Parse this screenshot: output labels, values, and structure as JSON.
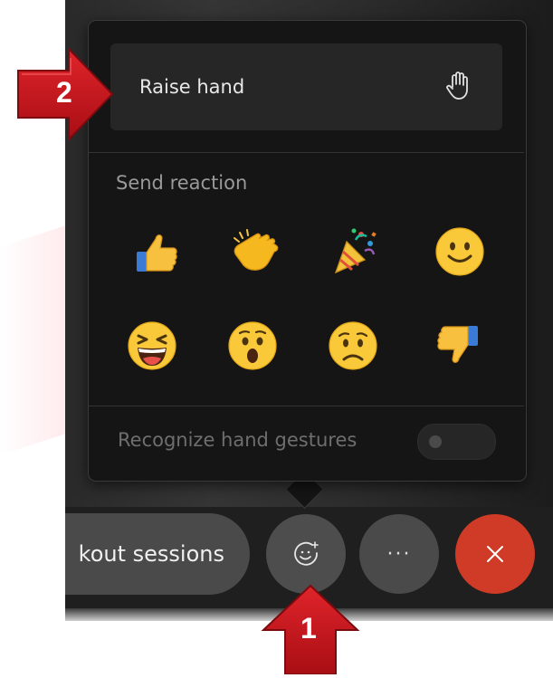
{
  "popup": {
    "raise_hand_label": "Raise hand",
    "send_reaction_title": "Send reaction",
    "reactions": [
      {
        "name": "like",
        "emoji": "👍"
      },
      {
        "name": "clap",
        "emoji": "👏"
      },
      {
        "name": "celebrate",
        "emoji": "🎉"
      },
      {
        "name": "smile",
        "emoji": "🙂"
      },
      {
        "name": "laugh",
        "emoji": "😆"
      },
      {
        "name": "surprised",
        "emoji": "😯"
      },
      {
        "name": "sad",
        "emoji": "🙁"
      },
      {
        "name": "dislike",
        "emoji": "👎"
      }
    ],
    "hand_gestures_label": "Recognize hand gestures",
    "hand_gestures_enabled": false
  },
  "toolbar": {
    "breakout_label": "kout sessions",
    "more_label": "···",
    "reactions_icon": "emoji-add-icon",
    "leave_icon": "close-icon",
    "leave_color": "#cf3b26"
  },
  "annotations": {
    "step1": "1",
    "step2": "2",
    "arrow_color": "#c8161b"
  }
}
